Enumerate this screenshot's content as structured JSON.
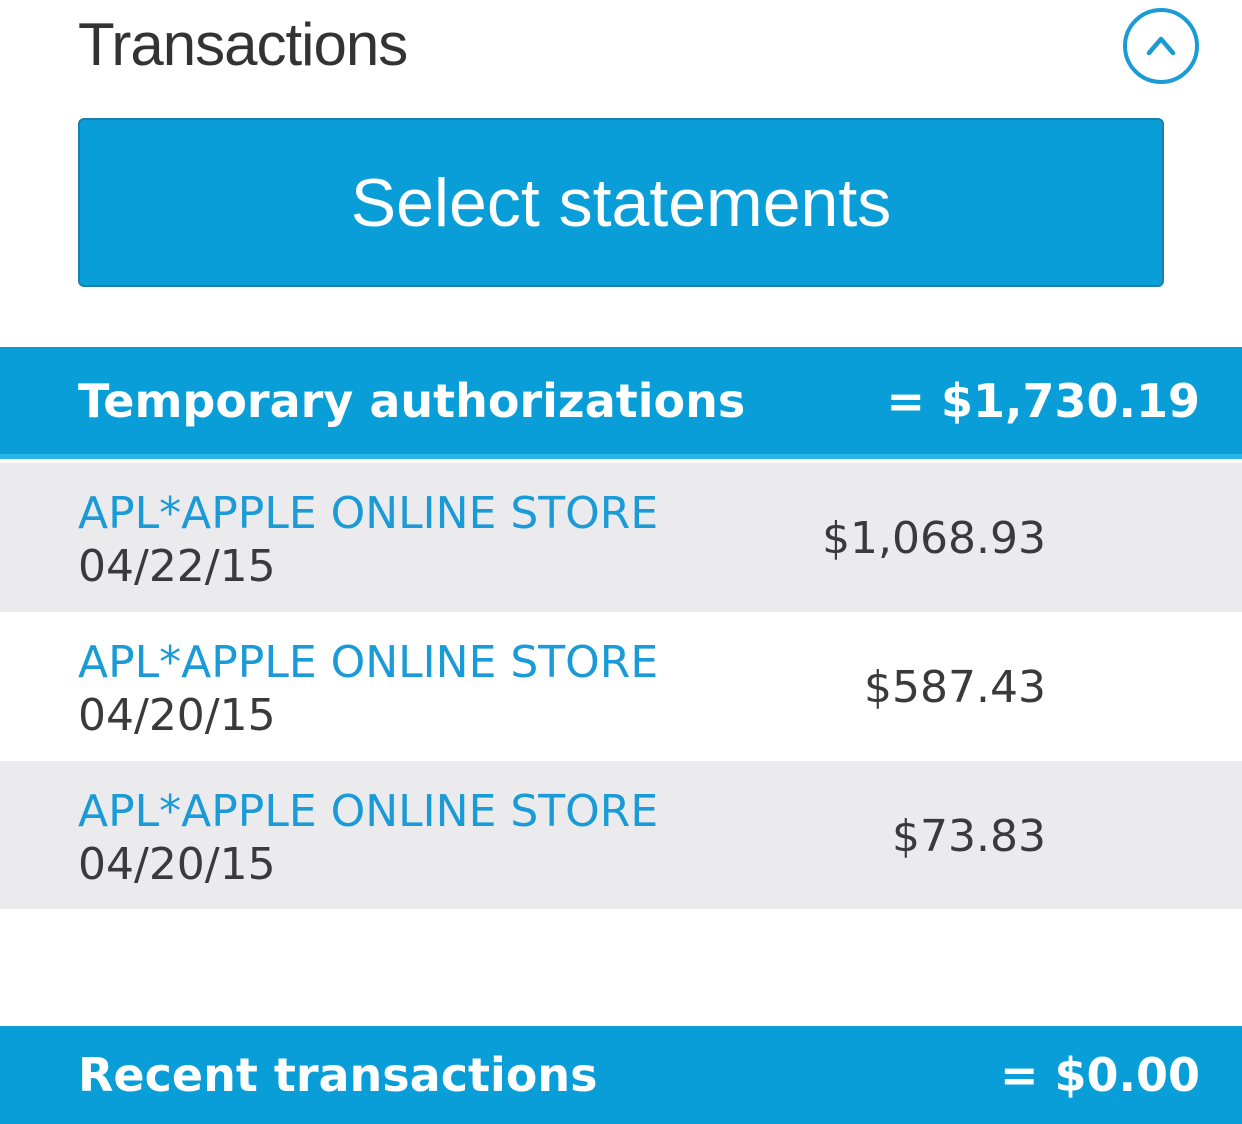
{
  "header": {
    "title": "Transactions",
    "collapse_icon": "chevron-up-icon"
  },
  "select_button": {
    "label": "Select statements"
  },
  "temporary_authorizations": {
    "label": "Temporary authorizations",
    "total": "= $1,730.19",
    "rows": [
      {
        "merchant": "APL*APPLE ONLINE STORE",
        "date": "04/22/15",
        "amount": "$1,068.93"
      },
      {
        "merchant": "APL*APPLE ONLINE STORE",
        "date": "04/20/15",
        "amount": "$587.43"
      },
      {
        "merchant": "APL*APPLE ONLINE STORE",
        "date": "04/20/15",
        "amount": "$73.83"
      }
    ]
  },
  "recent_transactions": {
    "label": "Recent transactions",
    "total": "= $0.00"
  },
  "colors": {
    "accent": "#0a9ed9",
    "link": "#1a9ad6",
    "row_shade": "#ebebed",
    "text": "#3a3a3a"
  }
}
